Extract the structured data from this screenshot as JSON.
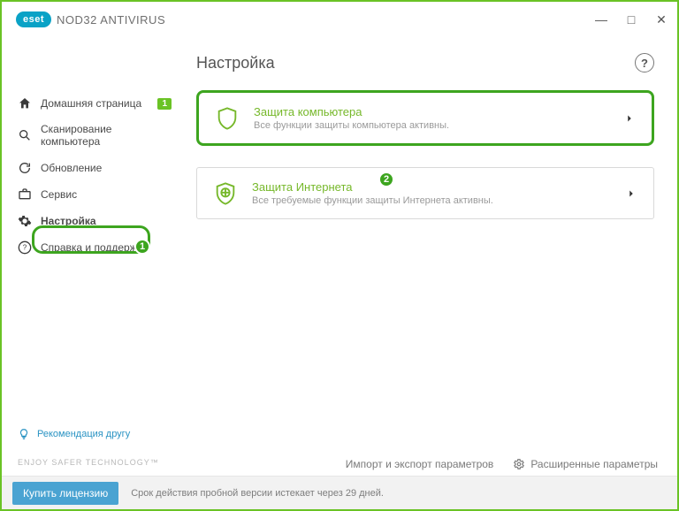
{
  "app": {
    "brand": "eset",
    "title": "NOD32 ANTIVIRUS"
  },
  "window_controls": {
    "min": "—",
    "max": "□",
    "close": "✕"
  },
  "sidebar": {
    "items": [
      {
        "label": "Домашняя страница",
        "badge": "1"
      },
      {
        "label": "Сканирование компьютера"
      },
      {
        "label": "Обновление"
      },
      {
        "label": "Сервис"
      },
      {
        "label": "Настройка"
      },
      {
        "label": "Справка и поддержка"
      }
    ],
    "recommend": "Рекомендация другу"
  },
  "page": {
    "title": "Настройка",
    "help": "?",
    "cards": [
      {
        "title": "Защита компьютера",
        "sub": "Все функции защиты компьютера активны."
      },
      {
        "title": "Защита Интернета",
        "sub": "Все требуемые функции защиты Интернета активны."
      }
    ]
  },
  "footer": {
    "import_export": "Импорт и экспорт параметров",
    "advanced": "Расширенные параметры",
    "tagline": "ENJOY SAFER TECHNOLOGY™"
  },
  "bottom": {
    "buy": "Купить лицензию",
    "trial": "Срок действия пробной версии истекает через 29 дней."
  },
  "steps": {
    "one": "1",
    "two": "2"
  }
}
